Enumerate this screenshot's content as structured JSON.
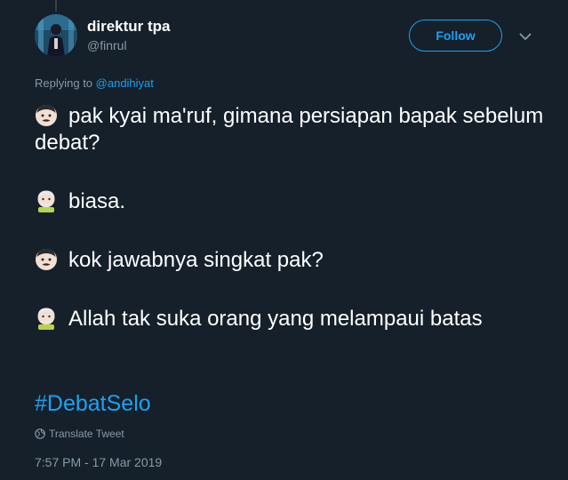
{
  "author": {
    "display_name": "direktur tpa",
    "handle": "@finrul",
    "avatar_icon": "avatar-photo"
  },
  "follow_label": "Follow",
  "reply": {
    "prefix": "Replying to ",
    "mention": "@andihiyat"
  },
  "lines": [
    {
      "speaker_icon": "man-emoji",
      "text": "pak kyai ma'ruf, gimana persiapan bapak sebelum debat?"
    },
    {
      "speaker_icon": "old-man-emoji",
      "text": "biasa."
    },
    {
      "speaker_icon": "man-emoji",
      "text": "kok jawabnya singkat pak?"
    },
    {
      "speaker_icon": "old-man-emoji",
      "text": "Allah tak suka orang yang melampaui batas"
    }
  ],
  "hashtag": "#DebatSelo",
  "translate_label": "Translate Tweet",
  "timestamp": "7:57 PM - 17 Mar 2019",
  "colors": {
    "background": "#15202b",
    "accent": "#1da1f2",
    "muted": "#8899a6"
  }
}
